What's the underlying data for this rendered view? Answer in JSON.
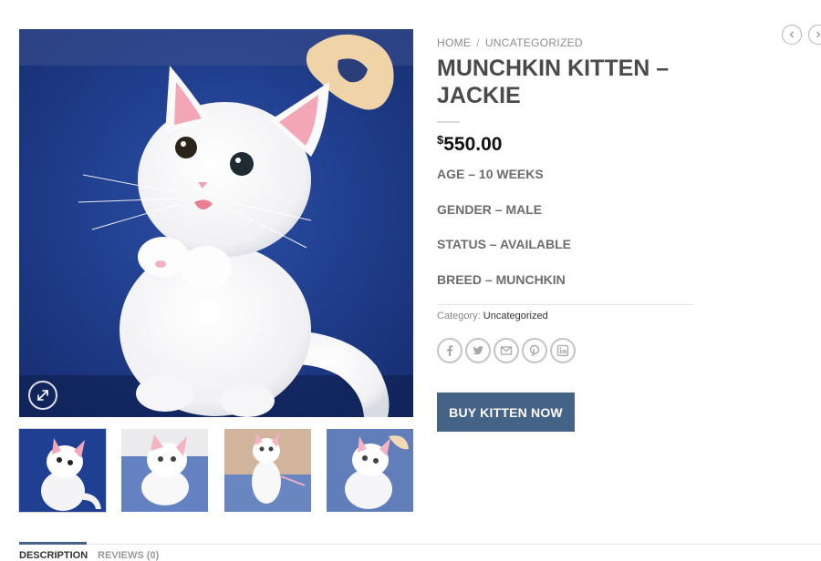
{
  "breadcrumb": {
    "home": "HOME",
    "separator": "/",
    "category": "UNCATEGORIZED"
  },
  "nav": {
    "prev_icon": "chevron-left-icon",
    "next_icon": "chevron-right-icon"
  },
  "product": {
    "title": "MUNCHKIN KITTEN – JACKIE",
    "currency_symbol": "$",
    "price": "550.00",
    "attributes": [
      "AGE – 10 WEEKS",
      "GENDER – MALE",
      "STATUS – AVAILABLE",
      "BREED – MUNCHKIN"
    ],
    "category_label": "Category:",
    "category_value": "Uncategorized",
    "buy_button": "BUY KITTEN NOW",
    "button_color": "#456287"
  },
  "gallery": {
    "main_image": "white-kitten-photo",
    "zoom_icon": "expand-icon",
    "thumbnails": [
      "white-kitten-thumb-1",
      "white-kitten-thumb-2",
      "white-kitten-thumb-3",
      "white-kitten-thumb-4"
    ]
  },
  "share": [
    "facebook-icon",
    "twitter-icon",
    "email-icon",
    "pinterest-icon",
    "linkedin-icon"
  ],
  "tabs": [
    {
      "label": "DESCRIPTION",
      "active": true
    },
    {
      "label": "REVIEWS (0)",
      "active": false
    }
  ]
}
